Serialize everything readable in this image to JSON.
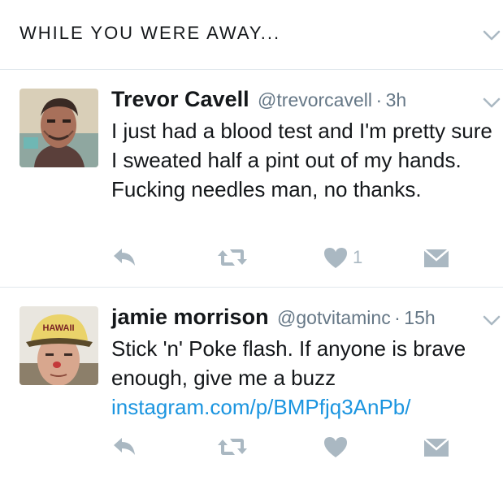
{
  "header": {
    "title": "WHILE YOU WERE AWAY..."
  },
  "colors": {
    "accent": "#1b95e0",
    "muted": "#aab8c2",
    "text": "#14171a",
    "secondary": "#657786",
    "divider": "#e1e8ed"
  },
  "tweets": [
    {
      "name": "Trevor Cavell",
      "handle": "@trevorcavell",
      "dot": "·",
      "time": "3h",
      "text": "I just had a blood test and I'm pretty sure I sweated half a pint out of my hands. Fucking needles man, no thanks.",
      "link": "",
      "like_count": "1",
      "avatar_icon": "painted-portrait-avatar"
    },
    {
      "name": "jamie morrison",
      "handle": "@gotvitaminc",
      "dot": "·",
      "time": "15h",
      "text": "Stick 'n' Poke flash. If anyone is brave enough, give me a buzz",
      "link": "instagram.com/p/BMPfjq3AnPb/",
      "like_count": "",
      "avatar_icon": "hawaii-cap-avatar",
      "avatar_cap_text": "HAWAII"
    }
  ],
  "icons": {
    "reply": "reply-icon",
    "retweet": "retweet-icon",
    "like": "heart-icon",
    "dm": "envelope-icon",
    "more": "chevron-down-icon"
  }
}
